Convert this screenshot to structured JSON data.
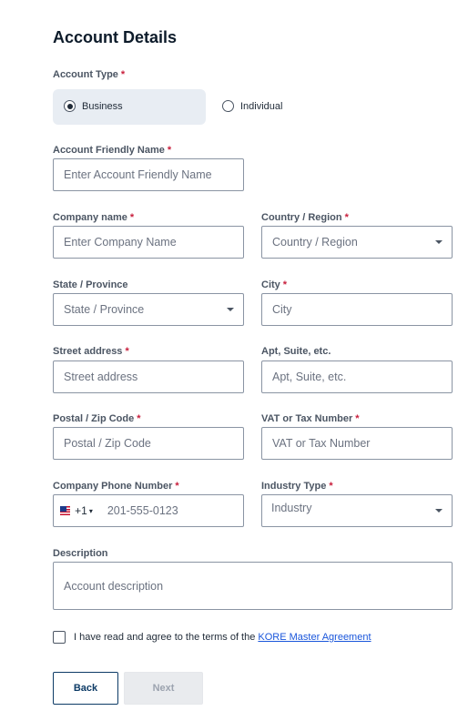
{
  "page": {
    "title": "Account Details"
  },
  "account_type": {
    "label": "Account Type",
    "required_mark": "*",
    "options": [
      {
        "label": "Business",
        "selected": true
      },
      {
        "label": "Individual",
        "selected": false
      }
    ]
  },
  "fields": {
    "friendly_name": {
      "label": "Account Friendly Name",
      "required_mark": "*",
      "placeholder": "Enter Account Friendly Name"
    },
    "company_name": {
      "label": "Company name",
      "required_mark": "*",
      "placeholder": "Enter Company Name"
    },
    "country": {
      "label": "Country / Region",
      "required_mark": "*",
      "value": "Country / Region"
    },
    "state": {
      "label": "State / Province",
      "value": "State / Province"
    },
    "city": {
      "label": "City",
      "required_mark": "*",
      "placeholder": "City"
    },
    "street": {
      "label": "Street address",
      "required_mark": "*",
      "placeholder": "Street address"
    },
    "apt": {
      "label": "Apt, Suite, etc.",
      "placeholder": "Apt, Suite, etc."
    },
    "postal": {
      "label": "Postal / Zip Code",
      "required_mark": "*",
      "placeholder": "Postal / Zip Code"
    },
    "vat": {
      "label": "VAT or Tax Number",
      "required_mark": "*",
      "placeholder": "VAT or Tax Number"
    },
    "phone": {
      "label": "Company Phone Number",
      "required_mark": "*",
      "dial_code": "+1",
      "placeholder": "201-555-0123"
    },
    "industry": {
      "label": "Industry Type",
      "required_mark": "*",
      "value": "Industry"
    },
    "description": {
      "label": "Description",
      "placeholder": "Account description"
    }
  },
  "agreement": {
    "text": "I have read and agree to the terms of the ",
    "link_text": "KORE Master Agreement",
    "checked": false
  },
  "buttons": {
    "back": "Back",
    "next": "Next"
  },
  "colors": {
    "accent": "#0d3b66",
    "required": "#c81e3c",
    "link": "#1a56db",
    "selected_pill": "#e8edf3"
  },
  "icons": {
    "flag": "us-flag-icon",
    "caret": "chevron-down-icon"
  }
}
